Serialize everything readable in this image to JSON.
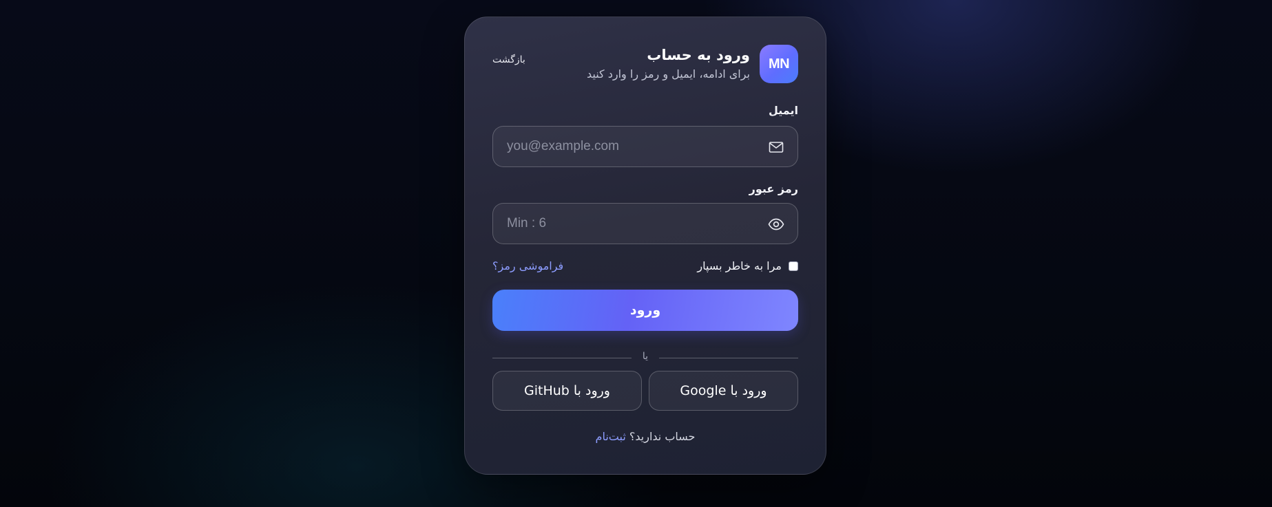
{
  "header": {
    "avatar_text": "MN",
    "title": "ورود به حساب",
    "subtitle": "برای ادامه، ایمیل و رمز را وارد کنید",
    "back_label": "بازگشت"
  },
  "email": {
    "label": "ایمیل",
    "placeholder": "you@example.com",
    "value": "",
    "icon": "mail-icon"
  },
  "password": {
    "label": "رمز عبور",
    "placeholder": "Min : 6",
    "value": "",
    "icon": "eye-icon"
  },
  "options": {
    "remember_label": "مرا به خاطر بسپار",
    "remember_checked": false,
    "forgot_label": "فراموشی رمز؟"
  },
  "submit_label": "ورود",
  "divider_text": "یا",
  "social": {
    "google_label": "ورود با Google",
    "github_label": "ورود با GitHub"
  },
  "signup": {
    "text": "حساب ندارید؟",
    "link": "ثبت‌نام"
  },
  "colors": {
    "accent": "#6462f6",
    "accent_secondary": "#4a80fb",
    "link": "#8d9dff",
    "card_background": "#252637",
    "page_background": "#050811"
  }
}
